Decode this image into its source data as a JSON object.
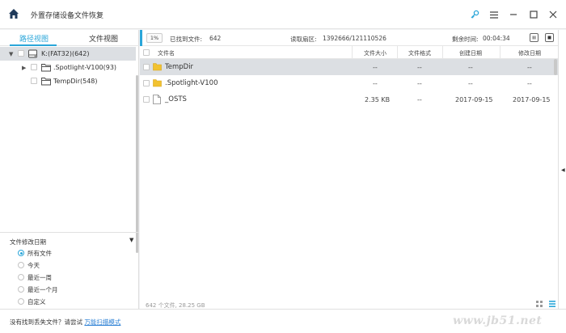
{
  "app": {
    "title": "外置存储设备文件恢复"
  },
  "left_panel": {
    "tabs": [
      {
        "label": "路径视图",
        "active": true
      },
      {
        "label": "文件视图",
        "active": false
      }
    ],
    "tree": [
      {
        "label": "K:(FAT32)(642)",
        "icon": "drive-icon",
        "selected": true
      },
      {
        "label": ".Spotlight-V100(93)",
        "icon": "folder-outline-icon",
        "selected": false
      },
      {
        "label": "TempDir(548)",
        "icon": "folder-outline-icon",
        "selected": false
      }
    ],
    "filter": {
      "title": "文件修改日期",
      "options": [
        {
          "label": "所有文件",
          "checked": true
        },
        {
          "label": "今天",
          "checked": false
        },
        {
          "label": "最近一周",
          "checked": false
        },
        {
          "label": "最近一个月",
          "checked": false
        },
        {
          "label": "自定义",
          "checked": false
        }
      ]
    }
  },
  "status": {
    "percent": "1%",
    "found_label": "已找到文件:",
    "found_value": "642",
    "read_label": "读取扇区:",
    "read_value": "1392666/121110526",
    "remaining_label": "剩余时间:",
    "remaining_value": "00:04:34"
  },
  "table": {
    "columns": [
      "文件名",
      "文件大小",
      "文件格式",
      "创建日期",
      "修改日期"
    ],
    "rows": [
      {
        "name": "TempDir",
        "size": "--",
        "format": "--",
        "created": "--",
        "modified": "--",
        "icon": "folder-icon",
        "selected": true
      },
      {
        "name": ".Spotlight-V100",
        "size": "--",
        "format": "--",
        "created": "--",
        "modified": "--",
        "icon": "folder-icon",
        "selected": false
      },
      {
        "name": "_OSTS",
        "size": "2.35 KB",
        "format": "--",
        "created": "2017-09-15",
        "modified": "2017-09-15",
        "icon": "file-icon",
        "selected": false
      }
    ]
  },
  "footer": {
    "summary": "642 个文件, 28.25 GB"
  },
  "bottom": {
    "hint": "没有找到丢失文件？请尝试",
    "link": "万能扫描模式"
  },
  "watermark": "www.jb51.net",
  "colors": {
    "accent": "#2aa6d9",
    "folder": "#f2c230",
    "link": "#2a7fd4",
    "selected_row": "#dcdfe3"
  }
}
